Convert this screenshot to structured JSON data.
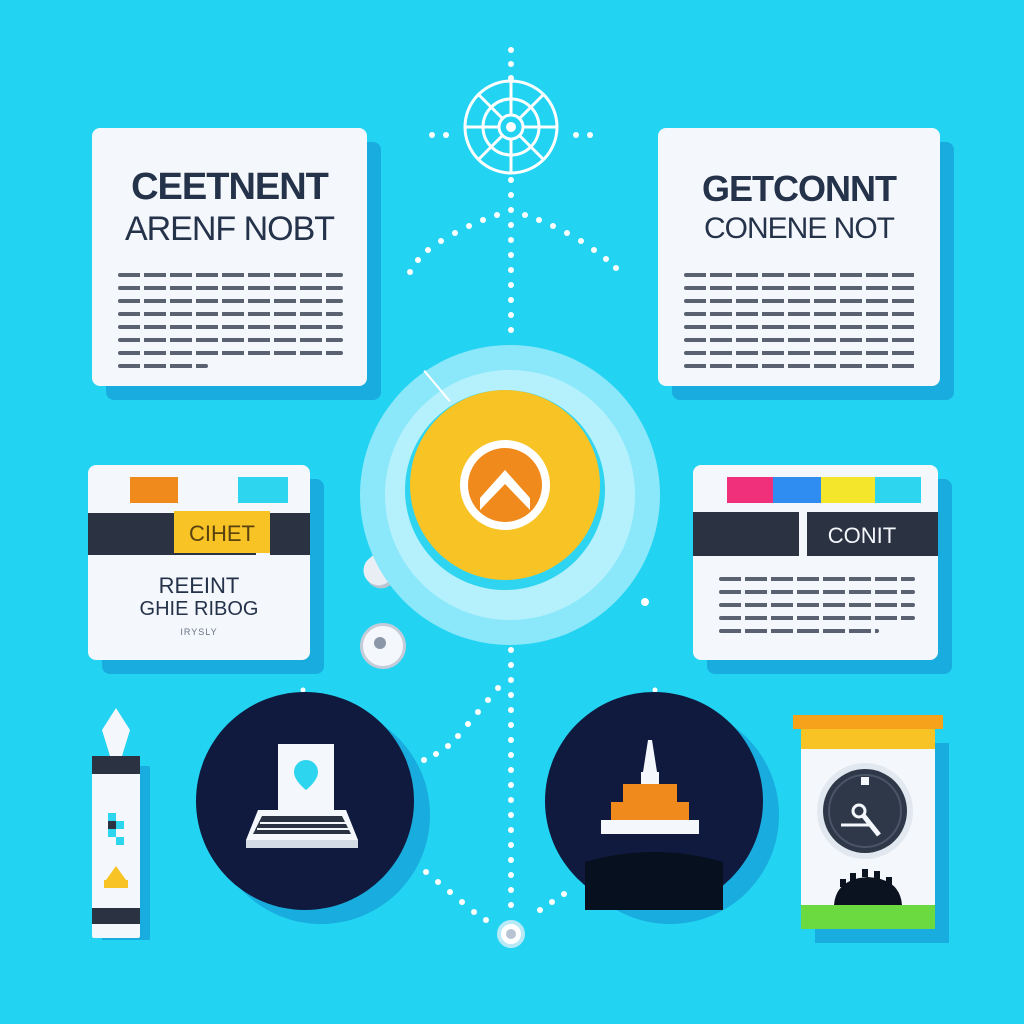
{
  "cards": {
    "top_left": {
      "title_line1": "CEETNENT",
      "title_line2": "ARENF NOBT"
    },
    "top_right": {
      "title_line1": "GETCONNT",
      "title_line2": "CONENE NOT"
    },
    "mid_left": {
      "tag": "CIHET",
      "title_line1": "REEINT",
      "title_line2": "GHIE RIBOG",
      "footnote": "IRYSLY"
    },
    "mid_right": {
      "bar_label": "CONIT"
    }
  },
  "colors": {
    "background": "#22d3f2",
    "card": "#f4f7fb",
    "dark": "#2b3343",
    "orange": "#f08a1c",
    "yellow": "#f7c325",
    "cyan": "#2ed5ef",
    "magenta": "#f0307a",
    "blue": "#2f8cf0",
    "navy": "#0f1a3e"
  },
  "icons": [
    "compass-icon",
    "chevron-up-icon",
    "magnifier-icon",
    "laptop-icon",
    "pedestal-icon",
    "battery-icon",
    "gauge-icon"
  ]
}
